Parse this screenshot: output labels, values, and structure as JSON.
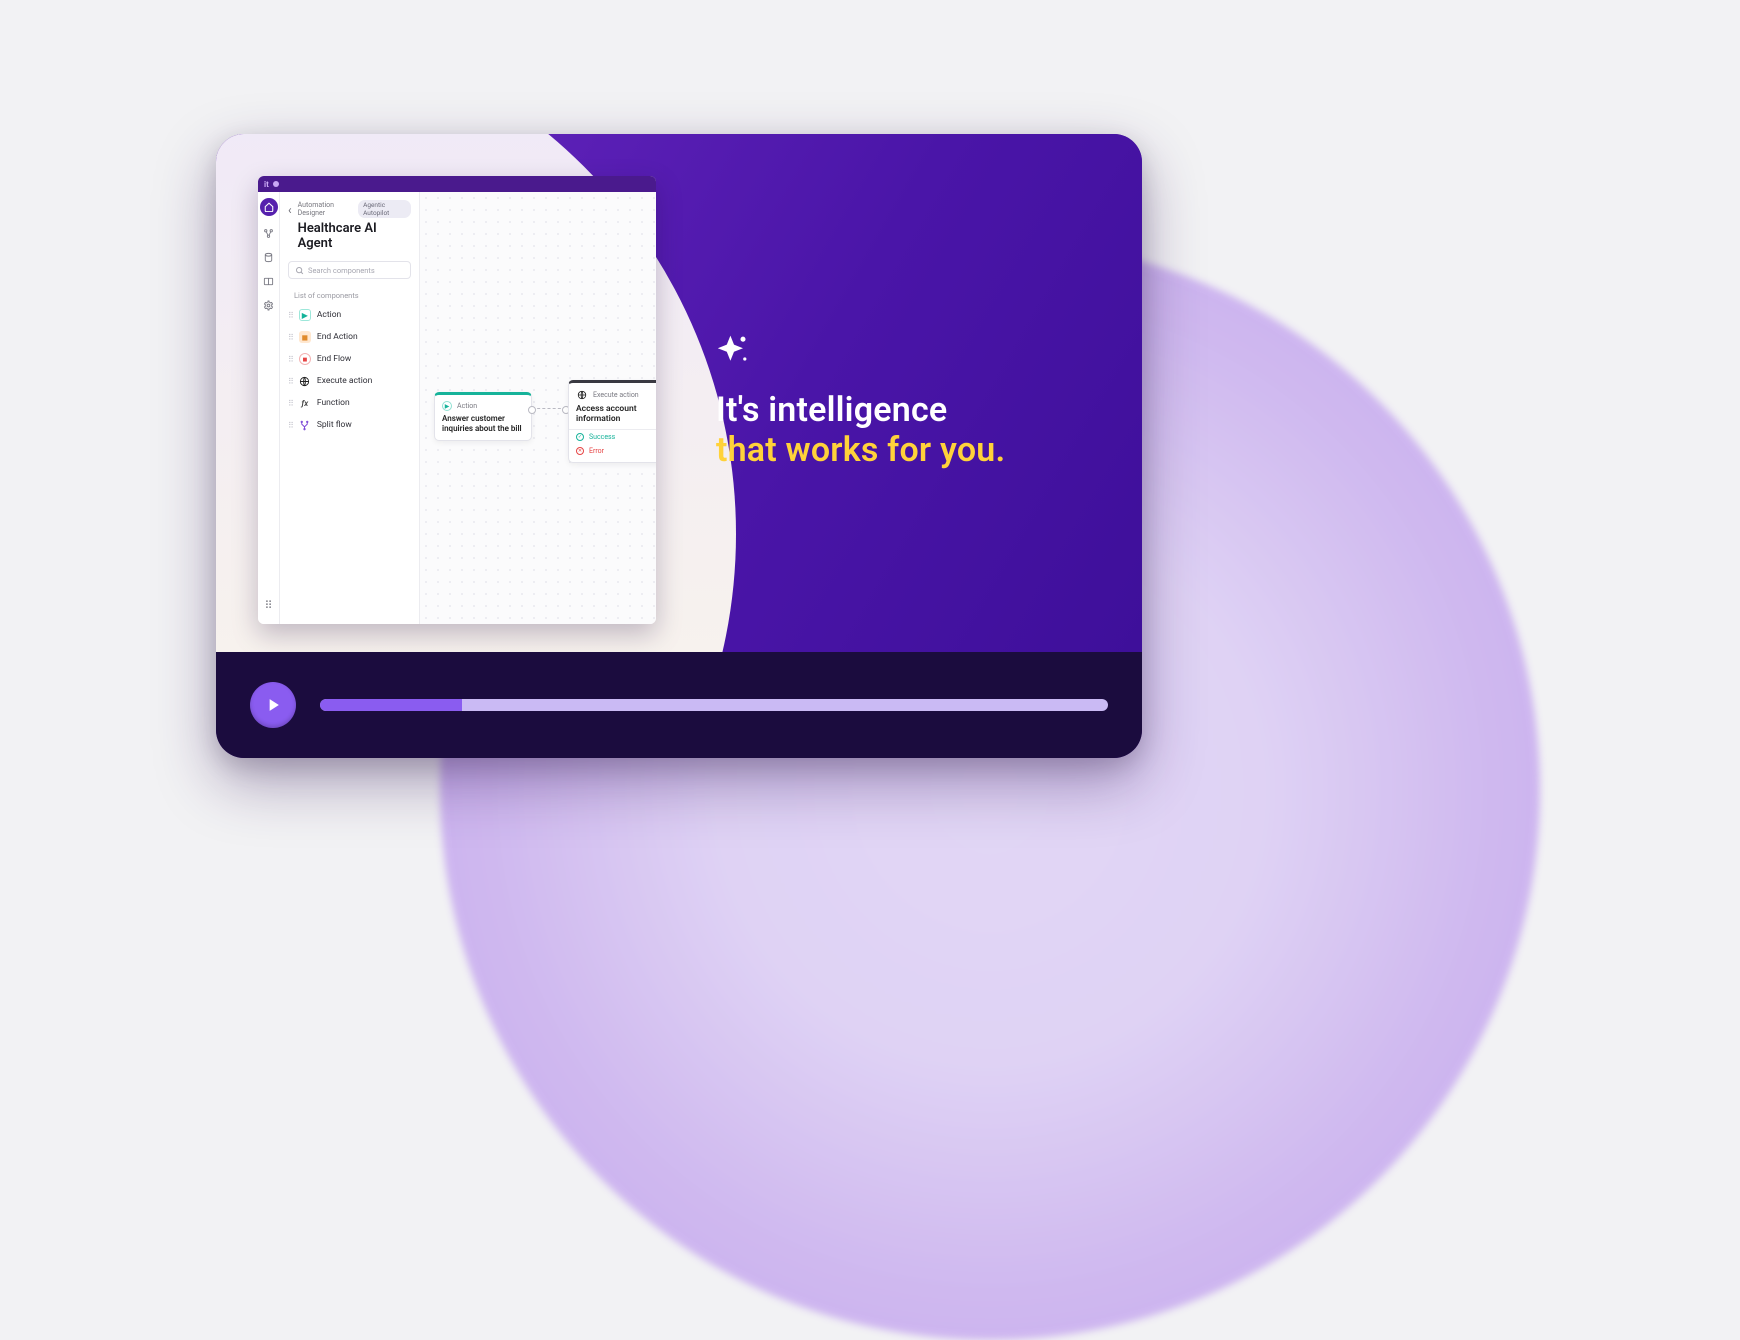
{
  "headline": {
    "line1": "It's intelligence",
    "line2": "that works for you."
  },
  "app": {
    "breadcrumb": {
      "root": "Automation Designer",
      "pill": "Agentic Autopilot"
    },
    "title": "Healthcare AI Agent",
    "search": {
      "placeholder": "Search components"
    },
    "list_heading": "List of components",
    "components": [
      {
        "label": "Action"
      },
      {
        "label": "End Action"
      },
      {
        "label": "End Flow"
      },
      {
        "label": "Execute action"
      },
      {
        "label": "Function"
      },
      {
        "label": "Split flow"
      }
    ],
    "canvas": {
      "cardA": {
        "tag": "Action",
        "text": "Answer customer inquiries about the bill"
      },
      "cardB": {
        "tag": "Execute action",
        "text": "Access account information",
        "status_success": "Success",
        "status_error": "Error"
      }
    }
  },
  "player": {
    "progress_percent": 18
  },
  "colors": {
    "accent_yellow": "#ffd23a",
    "accent_purple": "#8a5cf0",
    "deep_purple": "#1b0c3e"
  }
}
